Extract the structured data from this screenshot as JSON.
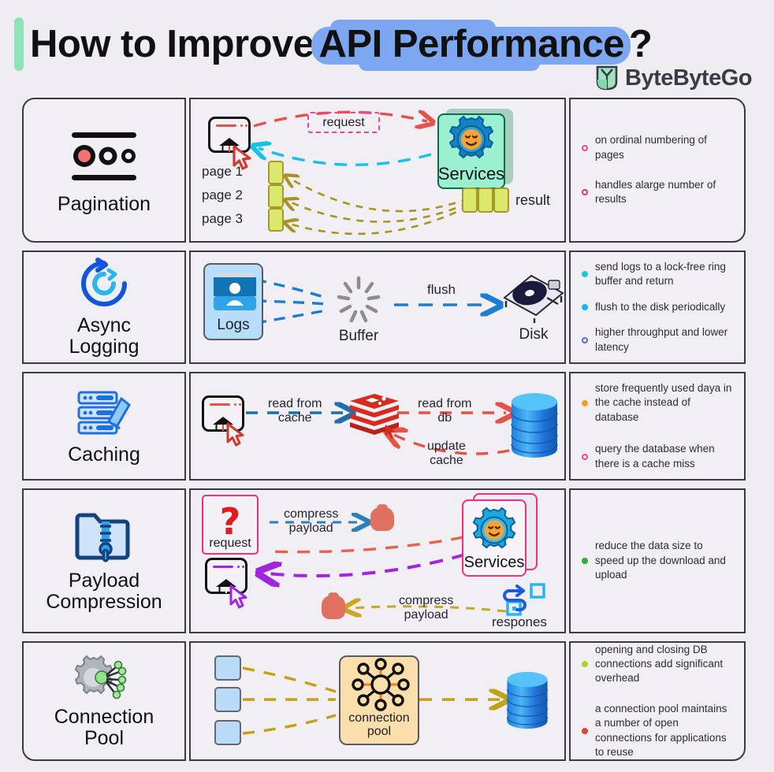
{
  "header": {
    "title_plain": "How to Improve",
    "title_highlight": "API Performance",
    "title_suffix": "?",
    "brand": "ByteByteGo",
    "highlight_color": "#7da7f0",
    "accent_color": "#8fe3b8"
  },
  "rows": [
    {
      "id": "pagination",
      "label": "Pagination",
      "icon": "pagination-dots-icon",
      "diagram": {
        "client": "",
        "request_label": "request",
        "service_label": "Services",
        "result_label": "result",
        "pages": [
          "page 1",
          "page 2",
          "page 3"
        ],
        "chip_color": "#dbe86b",
        "request_arrow_color": "#e8514a",
        "response_arrow_color": "#16c3e8",
        "page_arrow_color": "#a9931f"
      },
      "notes": [
        {
          "text": "on ordinal numbering of pages",
          "bullet_color": "#e8469a"
        },
        {
          "text": "handles alarge number of results",
          "bullet_color": "#e0306f"
        }
      ]
    },
    {
      "id": "async-logging",
      "label": "Async\nLogging",
      "icon": "async-refresh-icon",
      "diagram": {
        "logs_label": "Logs",
        "buffer_label": "Buffer",
        "disk_label": "Disk",
        "flush_label": "flush",
        "arrow_color": "#1a7fd4"
      },
      "notes": [
        {
          "text": "send logs to a lock-free ring buffer and return",
          "bullet_color": "#17c8e0"
        },
        {
          "text": "flush to the disk periodically",
          "bullet_color": "#18b6e8"
        },
        {
          "text": "higher throughput and lower latency",
          "bullet_color": "#4a6fd8"
        }
      ]
    },
    {
      "id": "caching",
      "label": "Caching",
      "icon": "server-broom-icon",
      "diagram": {
        "read_cache_label": "read from\ncache",
        "read_db_label": "read from\ndb",
        "update_cache_label": "update\ncache",
        "cache_icon": "redis-icon",
        "db_icon": "database-cylinder-icon",
        "blue_arrow_color": "#1f6fa8",
        "red_arrow_color": "#e8514a"
      },
      "notes": [
        {
          "text": "store frequently used daya in the cache instead of database",
          "bullet_color": "#f0a020"
        },
        {
          "text": "query the database when there is a cache miss",
          "bullet_color": "#e8469a"
        }
      ]
    },
    {
      "id": "payload-compression",
      "label": "Payload\nCompression",
      "icon": "zip-folder-icon",
      "diagram": {
        "request_label": "request",
        "compress_label_top": "compress\npayload",
        "compress_label_bottom": "compress\npayload",
        "service_label": "Services",
        "respones_label": "respones",
        "teal_arrow_color": "#2c7fb8",
        "salmon_arrow_color": "#e8614f",
        "purple_arrow_color": "#a224e0",
        "gold_arrow_color": "#c9a528"
      },
      "notes": [
        {
          "text": "reduce the data size to speed up the download and upload",
          "bullet_color": "#2bb32b"
        }
      ]
    },
    {
      "id": "connection-pool",
      "label": "Connection\nPool",
      "icon": "gear-nodes-icon",
      "diagram": {
        "pool_label": "connection\npool",
        "db_icon": "database-cylinder-icon",
        "arrow_color": "#c2a215",
        "client_box_color": "#b9dbf7",
        "pool_color": "#fadfad"
      },
      "notes": [
        {
          "text": "opening and closing DB connections add significant overhead",
          "bullet_color": "#a8d61a"
        },
        {
          "text": "a connection pool maintains a number of open connections for applications to reuse",
          "bullet_color": "#e04a2a"
        }
      ]
    }
  ]
}
